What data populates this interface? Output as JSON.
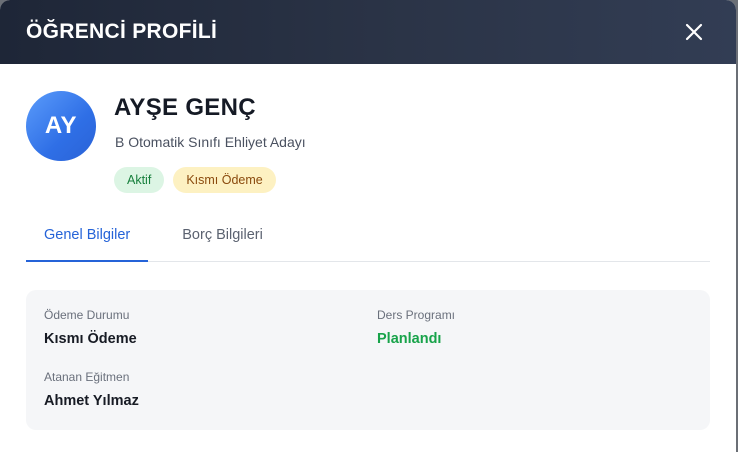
{
  "modal": {
    "title": "ÖĞRENCİ PROFİLİ",
    "close_icon": "close-icon"
  },
  "student": {
    "initials": "AY",
    "name": "AYŞE GENÇ",
    "subtitle": "B Otomatik Sınıfı Ehliyet Adayı",
    "badges": [
      {
        "label": "Aktif",
        "color": "#17803d",
        "bg": "#dcf5e4"
      },
      {
        "label": "Kısmı Ödeme",
        "color": "#8a4a0d",
        "bg": "#fdf1c2"
      }
    ]
  },
  "tabs": [
    {
      "label": "Genel Bilgiler",
      "active": true
    },
    {
      "label": "Borç Bilgileri",
      "active": false
    }
  ],
  "info": {
    "payment_status": {
      "label": "Ödeme Durumu",
      "value": "Kısmı Ödeme"
    },
    "lesson_program": {
      "label": "Ders Programı",
      "value": "Planlandı",
      "value_color": "#18a34a"
    },
    "instructor": {
      "label": "Atanan Eğitmen",
      "value": "Ahmet Yılmaz"
    }
  },
  "colors": {
    "header_bg": "#232c3e",
    "accent": "#2563d8",
    "avatar": "#3b7ff0"
  }
}
